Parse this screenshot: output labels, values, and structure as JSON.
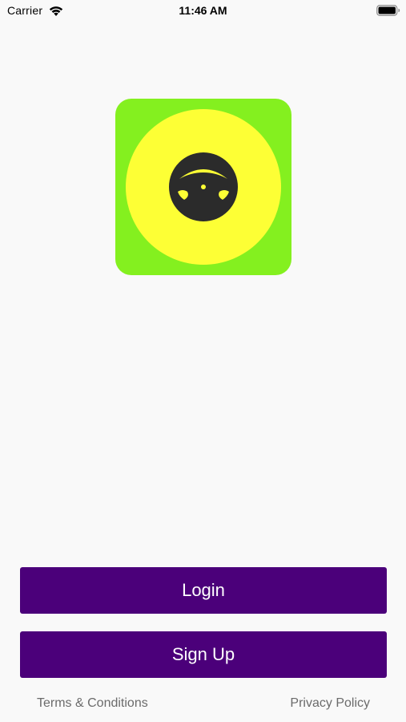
{
  "status_bar": {
    "carrier": "Carrier",
    "time": "11:46 AM",
    "wifi_icon": "wifi-icon",
    "battery_icon": "battery-icon"
  },
  "logo": {
    "icon": "steering-wheel-icon",
    "colors": {
      "tile": "#84f01f",
      "circle": "#fdff35",
      "wheel": "#2b2b2b"
    }
  },
  "actions": {
    "login_label": "Login",
    "signup_label": "Sign Up",
    "button_color": "#4b007a"
  },
  "footer": {
    "terms_label": "Terms & Conditions",
    "privacy_label": "Privacy Policy"
  }
}
